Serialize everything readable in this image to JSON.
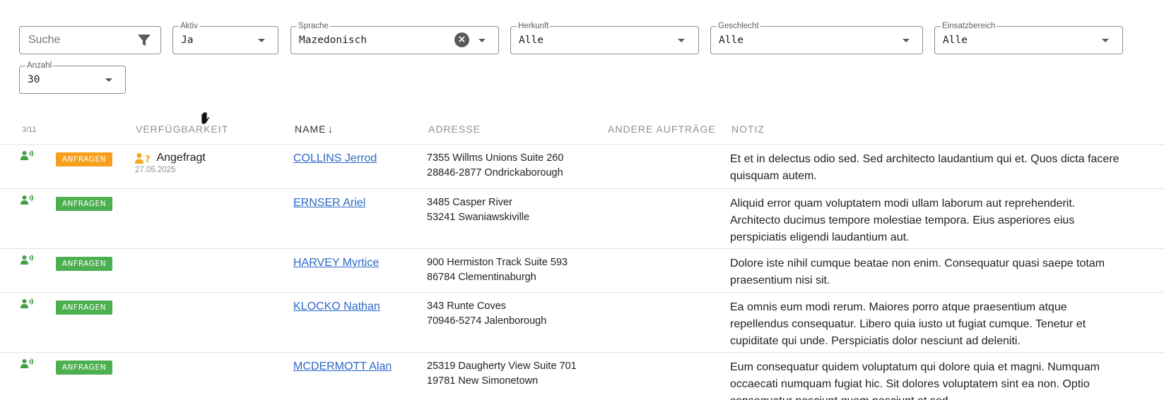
{
  "filters": {
    "search": {
      "placeholder": "Suche"
    },
    "aktiv": {
      "label": "Aktiv",
      "value": "Ja"
    },
    "sprache": {
      "label": "Sprache",
      "value": "Mazedonisch"
    },
    "herkunft": {
      "label": "Herkunft",
      "value": "Alle"
    },
    "geschlecht": {
      "label": "Geschlecht",
      "value": "Alle"
    },
    "einsatzbereich": {
      "label": "Einsatzbereich",
      "value": "Alle"
    },
    "anzahl": {
      "label": "Anzahl",
      "value": "30"
    }
  },
  "table": {
    "count": "3/11",
    "headers": {
      "availability": "VERFÜGBARKEIT",
      "name": "NAME",
      "address": "ADRESSE",
      "other_orders": "ANDERE AUFTRÄGE",
      "note": "NOTIZ"
    },
    "sort_arrow": "↓",
    "rows": [
      {
        "badge": "ANFRAGEN",
        "availability": "Angefragt",
        "availability_date": "27.05.2025",
        "name": "COLLINS Jerrod",
        "address_line1": "7355 Willms Unions Suite 260",
        "address_line2": "28846-2877 Ondrickaborough",
        "note_lines": [
          "Et et in delectus odio sed. Sed architecto laudantium qui et. Quos dicta facere",
          "quisquam autem."
        ]
      },
      {
        "badge": "ANFRAGEN",
        "name": "ERNSER Ariel",
        "address_line1": "3485 Casper River",
        "address_line2": "53241 Swaniawskiville",
        "note_lines": [
          "Aliquid error quam voluptatem modi ullam laborum aut reprehenderit.",
          "Architecto ducimus tempore molestiae tempora. Eius asperiores eius",
          "perspiciatis eligendi laudantium aut."
        ]
      },
      {
        "badge": "ANFRAGEN",
        "name": "HARVEY Myrtice",
        "address_line1": "900 Hermiston Track Suite 593",
        "address_line2": "86784 Clementinaburgh",
        "note_lines": [
          "Dolore iste nihil cumque beatae non enim. Consequatur quasi saepe totam",
          "praesentium nisi sit."
        ]
      },
      {
        "badge": "ANFRAGEN",
        "name": "KLOCKO Nathan",
        "address_line1": "343 Runte Coves",
        "address_line2": "70946-5274 Jalenborough",
        "note_lines": [
          "Ea omnis eum modi rerum. Maiores porro atque praesentium atque",
          "repellendus consequatur. Libero quia iusto ut fugiat cumque. Tenetur et",
          "cupiditate qui unde. Perspiciatis dolor nesciunt ad deleniti."
        ]
      },
      {
        "badge": "ANFRAGEN",
        "name": "MCDERMOTT Alan",
        "address_line1": "25319 Daugherty View Suite 701",
        "address_line2": "19781 New Simonetown",
        "note_lines": [
          "Eum consequatur quidem voluptatum qui dolore quia et magni. Numquam",
          "occaecati numquam fugiat hic. Sit dolores voluptatem sint ea non. Optio",
          "consequatur nesciunt quam nesciunt et sed."
        ]
      }
    ]
  },
  "colors": {
    "badge_orange": "#f7a01d",
    "badge_green": "#4caf50",
    "phone_green": "#43a047",
    "person_orange": "#f5a623",
    "link_blue": "#2b68c9"
  },
  "icons": {
    "filter": "filter-icon",
    "clear": "clear-icon",
    "dropdown": "chevron-down-icon",
    "phone": "speaking-person-icon",
    "requested": "person-question-icon",
    "cursor": "hand-cursor-icon"
  }
}
